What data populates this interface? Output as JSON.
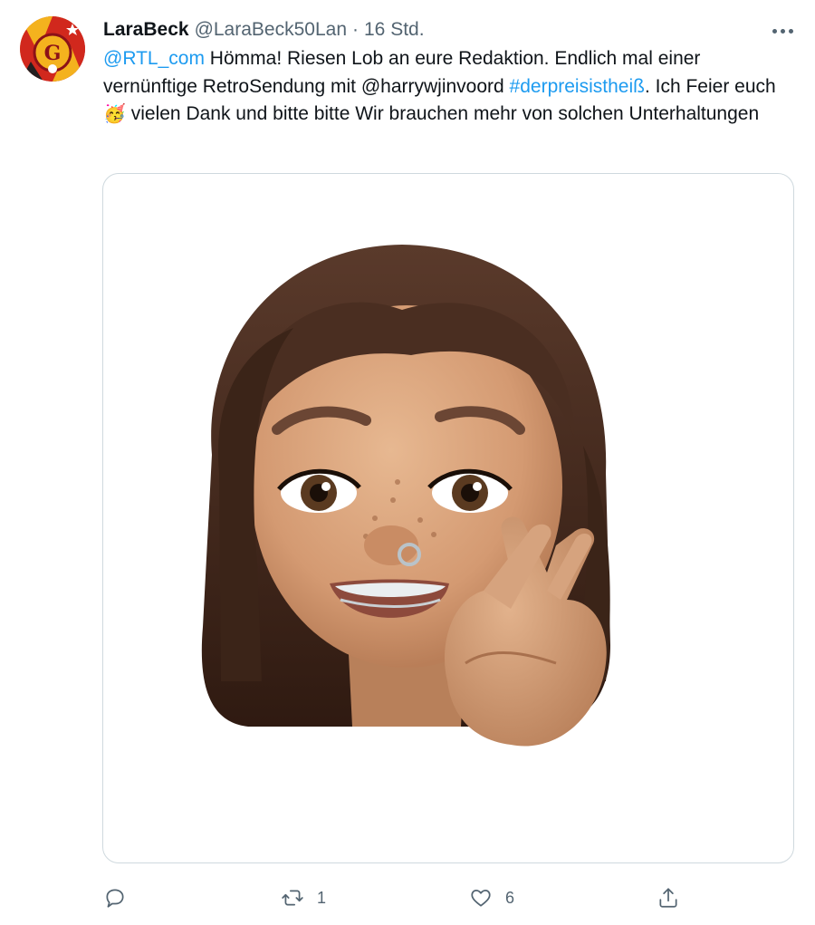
{
  "tweet": {
    "author_name": "LaraBeck",
    "author_handle": "@LaraBeck50Lan",
    "separator": "·",
    "time": "16 Std.",
    "text": {
      "mention1": "@RTL_com",
      "part1": " Hömma! Riesen Lob an eure Redaktion. Endlich mal einer vernünftige RetroSendung mit @harrywjinvoord ",
      "hashtag": "#derpreisistheiß",
      "part2": ". Ich Feier euch ",
      "emoji": "🥳",
      "part3": " vielen Dank und bitte bitte Wir brauchen mehr von solchen Unterhaltungen"
    },
    "media_alt": "Memoji girl peace sign",
    "actions": {
      "reply_count": "",
      "retweet_count": "1",
      "like_count": "6"
    }
  },
  "colors": {
    "link": "#1d9bf0",
    "secondary_text": "#536471",
    "border": "#cfd9de"
  },
  "icons": {
    "more": "more-horizontal-icon",
    "reply": "reply-icon",
    "retweet": "retweet-icon",
    "like": "heart-icon",
    "share": "share-icon"
  }
}
